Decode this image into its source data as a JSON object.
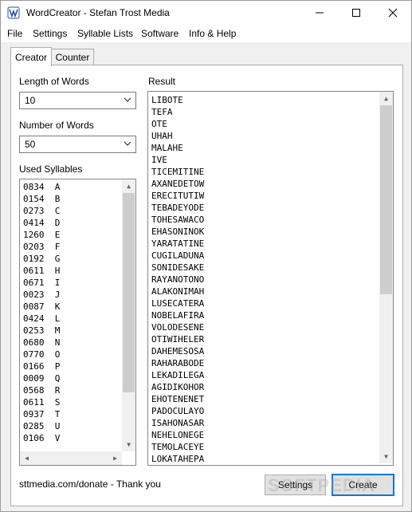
{
  "window": {
    "title": "WordCreator - Stefan Trost Media"
  },
  "menu": [
    "File",
    "Settings",
    "Syllable Lists",
    "Software",
    "Info & Help"
  ],
  "tabs": [
    {
      "label": "Creator",
      "active": true
    },
    {
      "label": "Counter",
      "active": false
    }
  ],
  "creator": {
    "length_label": "Length of Words",
    "length_value": "10",
    "number_label": "Number of Words",
    "number_value": "50",
    "syllables_label": "Used Syllables",
    "syllables": [
      "0834  A",
      "0154  B",
      "0273  C",
      "0414  D",
      "1260  E",
      "0203  F",
      "0192  G",
      "0611  H",
      "0671  I",
      "0023  J",
      "0087  K",
      "0424  L",
      "0253  M",
      "0680  N",
      "0770  O",
      "0166  P",
      "0009  Q",
      "0568  R",
      "0611  S",
      "0937  T",
      "0285  U",
      "0106  V"
    ],
    "result_label": "Result",
    "results": [
      "LIBOTE",
      "TEFA",
      "OTE",
      "UHAH",
      "MALAHE",
      "IVE",
      "TICEMITINE",
      "AXANEDETOW",
      "ERECITUTIW",
      "TEBADEYODE",
      "TOHESAWACO",
      "EHASONINOK",
      "YARATATINE",
      "CUGILADUNA",
      "SONIDESAKE",
      "RAYANOTONO",
      "ALAKONIMAH",
      "LUSECATERA",
      "NOBELAFIRA",
      "VOLODESENE",
      "OTIWIHELER",
      "DAHEMESOSA",
      "RAHARABODE",
      "LEKADILEGA",
      "AGIDIKOHOR",
      "EHOTENENET",
      "PADOCULAYO",
      "ISAHONASAR",
      "NEHELONEGE",
      "TEMOLACEYE",
      "LOKATAHEPA"
    ]
  },
  "footer": {
    "donate_text": "sttmedia.com/donate - Thank you",
    "settings_button": "Settings",
    "create_button": "Create"
  },
  "watermark": "SOFTPEDIA",
  "accent_color": "#0078d7"
}
